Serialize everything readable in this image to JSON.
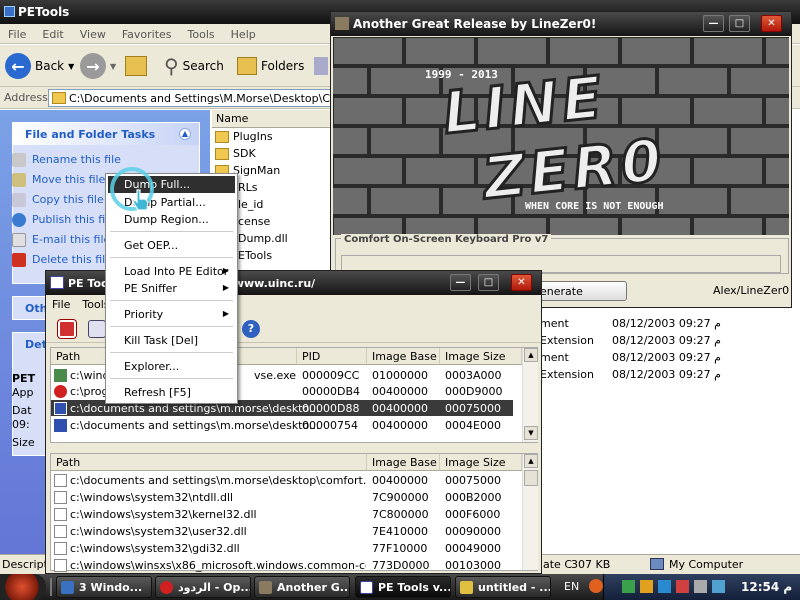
{
  "explorer": {
    "title": "PETools",
    "menu": [
      "File",
      "Edit",
      "View",
      "Favorites",
      "Tools",
      "Help"
    ],
    "toolbar": {
      "back": "Back",
      "search": "Search",
      "folders": "Folders"
    },
    "address_label": "Address",
    "address_value": "C:\\Documents and Settings\\M.Morse\\Desktop\\Comfort",
    "task_pane": {
      "file_tasks_title": "File and Folder Tasks",
      "items": [
        "Rename this file",
        "Move this file",
        "Copy this file",
        "Publish this file",
        "E-mail this file",
        "Delete this file"
      ],
      "other_title": "Oth",
      "details_title": "Det",
      "details_lines": [
        "PET",
        "App",
        "Dat",
        "09:",
        "Size"
      ]
    },
    "filelist": {
      "name_header": "Name",
      "items": [
        "PlugIns",
        "SDK",
        "SignMan",
        "RLs",
        "le_id",
        "cense",
        "Dump.dll",
        "ETools"
      ]
    },
    "details_rows": [
      {
        "type": "ment",
        "date": "08/12/2003 09:27 م"
      },
      {
        "type": "Extension",
        "date": "08/12/2003 09:27 م"
      },
      {
        "type": "ment",
        "date": "08/12/2003 09:27 م"
      },
      {
        "type": "Extension",
        "date": "08/12/2003 09:27 م"
      }
    ],
    "status": {
      "left": "Descripti",
      "mid": "ate C",
      "size": "307 KB",
      "zone": "My Computer"
    }
  },
  "linezero": {
    "title": "Another Great Release by LineZer0!",
    "years": "1999 - 2013",
    "logo_line1": "LINE",
    "logo_line2": "ZER0",
    "tagline": "WHEN CORE IS NOT ENOUGH",
    "group_title": "Comfort On-Screen Keyboard Pro v7",
    "generate": "enerate",
    "credit": "Alex/LineZer0"
  },
  "petools": {
    "title": "PE Too  NEOx/[uinC], http://www.uinc.ru/",
    "menu": [
      "File",
      "Tools"
    ],
    "process_headers": {
      "path": "Path",
      "pid": "PID",
      "base": "Image Base",
      "size": "Image Size"
    },
    "processes": [
      {
        "path": "c:\\windows\\explorer.exe",
        "pid": "000009CC",
        "base": "01000000",
        "size": "0003A000",
        "icon": "#4a8a4a"
      },
      {
        "path": "c:\\program files\\opera\\opera.exe",
        "pid": "00000DB4",
        "base": "00400000",
        "size": "000D9000",
        "icon": "#d02020"
      },
      {
        "path": "c:\\documents and settings\\m.morse\\deskto...",
        "pid": "00000D88",
        "base": "00400000",
        "size": "00075000",
        "icon": "#3050b0"
      },
      {
        "path": "c:\\documents and settings\\m.morse\\deskto...",
        "pid": "00000754",
        "base": "00400000",
        "size": "0004E000",
        "icon": "#3050b0"
      }
    ],
    "process_path_visible": [
      "c:\\wind",
      "c:\\prog",
      "c:\\documents and settings\\m.morse\\deskto...",
      "c:\\documents and settings\\m.morse\\deskto..."
    ],
    "proc_suffix_first": "vse.exe",
    "module_headers": {
      "path": "Path",
      "base": "Image Base",
      "size": "Image Size"
    },
    "modules": [
      {
        "path": "c:\\documents and settings\\m.morse\\desktop\\comfort.on-s...",
        "base": "00400000",
        "size": "00075000"
      },
      {
        "path": "c:\\windows\\system32\\ntdll.dll",
        "base": "7C900000",
        "size": "000B2000"
      },
      {
        "path": "c:\\windows\\system32\\kernel32.dll",
        "base": "7C800000",
        "size": "000F6000"
      },
      {
        "path": "c:\\windows\\system32\\user32.dll",
        "base": "7E410000",
        "size": "00090000"
      },
      {
        "path": "c:\\windows\\system32\\gdi32.dll",
        "base": "77F10000",
        "size": "00049000"
      },
      {
        "path": "c:\\windows\\winsxs\\x86_microsoft.windows.common-contr...",
        "base": "773D0000",
        "size": "00103000"
      }
    ]
  },
  "context_menu": {
    "items": [
      "Dump Full...",
      "Dump Partial...",
      "Dump Region...",
      "Get OEP...",
      "Load Into PE Editor",
      "PE Sniffer",
      "Priority",
      "Kill Task  [Del]",
      "Explorer...",
      "Refresh  [F5]"
    ]
  },
  "taskbar": {
    "tasks": [
      "3 Windo...",
      "الردود - Op...",
      "Another G...",
      "PE Tools v...",
      "untitled - ..."
    ],
    "lang": "EN",
    "clock": "12:54 م"
  }
}
